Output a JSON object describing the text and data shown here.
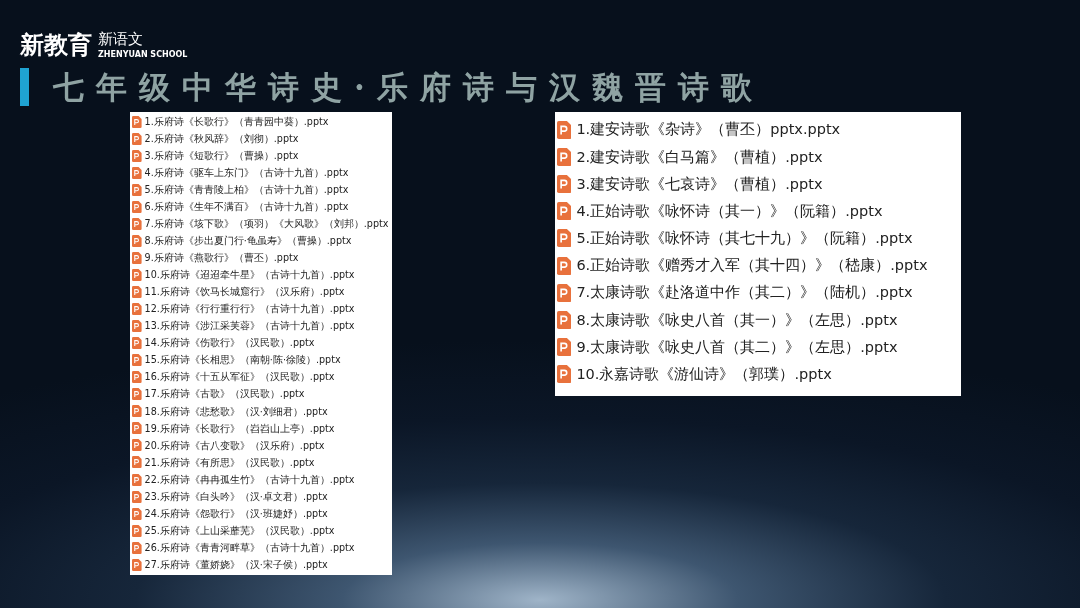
{
  "logo": {
    "mark": "新教育",
    "name": "新语文",
    "subtitle": "ZHENYUAN SCHOOL"
  },
  "title": "七年级中华诗史·乐府诗与汉魏晋诗歌",
  "left_files": [
    "1.乐府诗《长歌行》（青青园中葵）.pptx",
    "2.乐府诗《秋风辞》（刘彻）.pptx",
    "3.乐府诗《短歌行》（曹操）.pptx",
    "4.乐府诗《驱车上东门》（古诗十九首）.pptx",
    "5.乐府诗《青青陵上柏》（古诗十九首）.pptx",
    "6.乐府诗《生年不满百》（古诗十九首）.pptx",
    "7.乐府诗《垓下歌》（项羽）《大风歌》（刘邦）.pptx",
    "8.乐府诗《步出夏门行·龟虽寿》（曹操）.pptx",
    "9.乐府诗《燕歌行》（曹丕）.pptx",
    "10.乐府诗《迢迢牵牛星》（古诗十九首）.pptx",
    "11.乐府诗《饮马长城窟行》（汉乐府）.pptx",
    "12.乐府诗《行行重行行》（古诗十九首）.pptx",
    "13.乐府诗《涉江采芙蓉》（古诗十九首）.pptx",
    "14.乐府诗《伤歌行》（汉民歌）.pptx",
    "15.乐府诗《长相思》（南朝·陈·徐陵）.pptx",
    "16.乐府诗《十五从军征》（汉民歌）.pptx",
    "17.乐府诗《古歌》（汉民歌）.pptx",
    "18.乐府诗《悲愁歌》（汉·刘细君）.pptx",
    "19.乐府诗《长歌行》（岧岧山上亭）.pptx",
    "20.乐府诗《古八变歌》（汉乐府）.pptx",
    "21.乐府诗《有所思》（汉民歌）.pptx",
    "22.乐府诗《冉冉孤生竹》（古诗十九首）.pptx",
    "23.乐府诗《白头吟》（汉·卓文君）.pptx",
    "24.乐府诗《怨歌行》（汉·班婕妤）.pptx",
    "25.乐府诗《上山采蘼芜》（汉民歌）.pptx",
    "26.乐府诗《青青河畔草》（古诗十九首）.pptx",
    "27.乐府诗《董娇娆》（汉·宋子侯）.pptx"
  ],
  "right_files": [
    "1.建安诗歌《杂诗》（曹丕）pptx.pptx",
    "2.建安诗歌《白马篇》（曹植）.pptx",
    "3.建安诗歌《七哀诗》（曹植）.pptx",
    "4.正始诗歌《咏怀诗（其一）》（阮籍）.pptx",
    "5.正始诗歌《咏怀诗（其七十九）》（阮籍）.pptx",
    "6.正始诗歌《赠秀才入军（其十四）》（嵇康）.pptx",
    "7.太康诗歌《赴洛道中作（其二）》（陆机）.pptx",
    "8.太康诗歌《咏史八首（其一）》（左思）.pptx",
    "9.太康诗歌《咏史八首（其二）》（左思）.pptx",
    "10.永嘉诗歌《游仙诗》（郭璞）.pptx"
  ]
}
